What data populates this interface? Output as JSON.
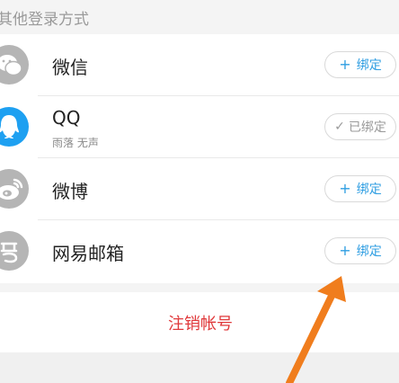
{
  "other_login": {
    "section_title": "其他登录方式",
    "accounts": [
      {
        "name": "微信",
        "icon": "wechat-icon",
        "button": {
          "glyph": "+",
          "label": "绑定"
        }
      },
      {
        "name": "QQ",
        "subtitle": "雨落 无声",
        "icon": "qq-icon",
        "button": {
          "glyph": "✓",
          "label": "已绑定"
        }
      },
      {
        "name": "微博",
        "icon": "weibo-icon",
        "button": {
          "glyph": "+",
          "label": "绑定"
        }
      },
      {
        "name": "网易邮箱",
        "icon": "netease-mail-icon",
        "button": {
          "glyph": "+",
          "label": "绑定"
        }
      }
    ]
  },
  "logout_label": "注销帐号",
  "colors": {
    "accent": "#2f9ee2",
    "danger": "#e0393b",
    "qq_brand": "#1ea0f1",
    "annotation_arrow": "#f07d1d"
  }
}
